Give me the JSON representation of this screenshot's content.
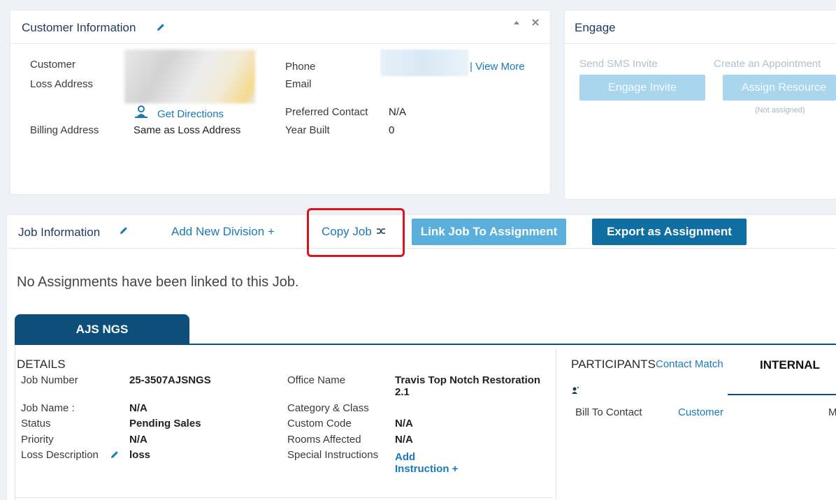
{
  "customer_panel": {
    "title": "Customer Information",
    "collapse_icon": "caret-up-icon",
    "close_icon": "close-icon",
    "labels": {
      "customer": "Customer",
      "loss_address": "Loss Address",
      "billing_address": "Billing Address",
      "phone": "Phone",
      "email": "Email",
      "preferred_contact": "Preferred Contact",
      "year_built": "Year Built"
    },
    "values": {
      "billing_address": "Same as Loss Address",
      "preferred_contact": "N/A",
      "year_built": "0"
    },
    "get_directions": "Get Directions",
    "view_more": "| View More"
  },
  "engage_panel": {
    "title": "Engage",
    "send_sms_label": "Send SMS Invite",
    "create_appt_label": "Create an Appointment",
    "engage_invite_button": "Engage Invite",
    "assign_resource_button": "Assign Resource",
    "not_assigned": "(Not assigned)"
  },
  "job_panel": {
    "title": "Job Information",
    "add_division": "Add New Division +",
    "copy_job": "Copy Job",
    "link_job_button": "Link Job To Assignment",
    "export_button": "Export as Assignment",
    "no_assignments": "No Assignments have been linked to this Job.",
    "tab": "AJS NGS",
    "highlight_color": "#d9141b"
  },
  "details": {
    "heading": "DETAILS",
    "job_number_label": "Job Number",
    "job_number": "25-3507AJSNGS",
    "job_name_label": "Job Name :",
    "job_name": "N/A",
    "status_label": "Status",
    "status": "Pending Sales",
    "priority_label": "Priority",
    "priority": "N/A",
    "loss_description_label": "Loss Description",
    "loss_description": "loss",
    "office_name_label": "Office Name",
    "office_name_line1": "Travis Top Notch Restoration",
    "office_name_line2": "2.1",
    "category_class_label": "Category & Class",
    "custom_code_label": "Custom Code",
    "custom_code": "N/A",
    "rooms_affected_label": "Rooms Affected",
    "rooms_affected": "N/A",
    "special_instructions_label": "Special Instructions",
    "add_instruction_line1": "Add",
    "add_instruction_line2": "Instruction +"
  },
  "participants": {
    "heading": "PARTICIPANTS",
    "contact_match": "Contact Match",
    "internal_tab": "INTERNAL",
    "bill_to_label": "Bill To Contact",
    "bill_to_value": "Customer",
    "trailing_char": "M"
  }
}
